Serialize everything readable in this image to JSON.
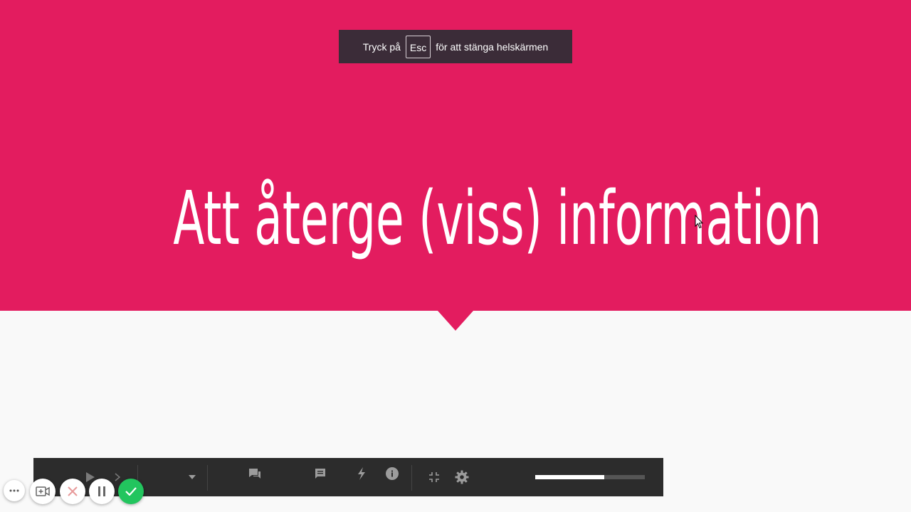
{
  "slide": {
    "title": "Att återge (viss) information",
    "accent_color": "#e31c5f",
    "background_color": "#f9f9f9"
  },
  "fullscreen_notice": {
    "prefix": "Tryck på",
    "key": "Esc",
    "suffix": "för att stänga helskärmen"
  },
  "player_toolbar": {
    "icons": [
      "play-icon",
      "next-icon",
      "dropdown-icon",
      "comment-icon",
      "notes-icon",
      "flash-icon",
      "info-icon",
      "exit-fullscreen-icon",
      "gear-icon"
    ],
    "progress_fraction": 0.63
  },
  "recorder_controls": {
    "icons": [
      "more-icon",
      "camera-add-icon",
      "close-icon",
      "pause-icon",
      "check-icon"
    ],
    "confirm_color": "#22c55e",
    "cancel_color": "#e89a9a"
  }
}
